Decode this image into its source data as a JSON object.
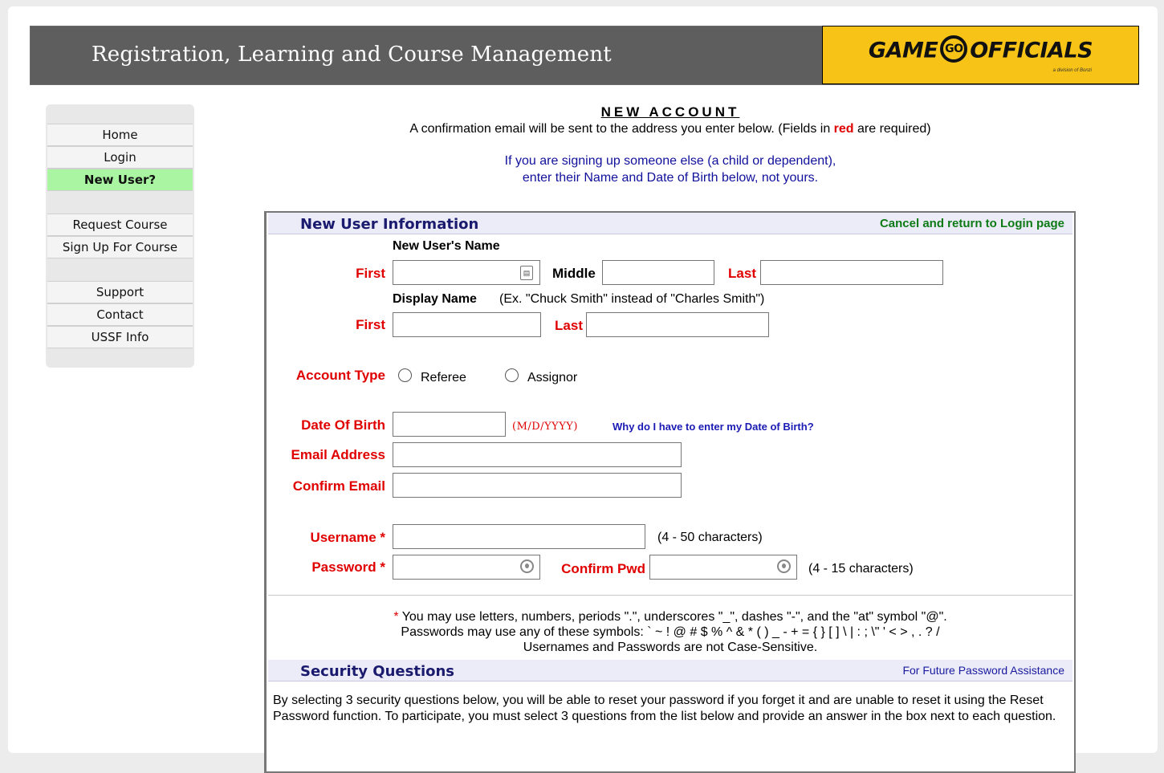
{
  "header": {
    "title": "Registration, Learning and Course Management",
    "logo_left": "GAME",
    "logo_mid": "GO",
    "logo_right": "OFFICIALS",
    "logo_sub": "a division of Bonzi"
  },
  "sidebar": {
    "items": [
      {
        "label": "Home"
      },
      {
        "label": "Login"
      },
      {
        "label": "New User?"
      },
      {
        "label": "Request Course"
      },
      {
        "label": "Sign Up For Course"
      },
      {
        "label": "Support"
      },
      {
        "label": "Contact"
      },
      {
        "label": "USSF Info"
      }
    ]
  },
  "intro": {
    "heading": "NEW ACCOUNT",
    "line1_pre": "A confirmation email will be sent to the address you enter below. (Fields in ",
    "line1_red": "red",
    "line1_post": " are required)",
    "line2": "If you are signing up someone else (a child or dependent),",
    "line3": "enter their Name and Date of Birth below, not yours."
  },
  "user_info": {
    "title": "New User Information",
    "cancel_link": "Cancel and return to Login page",
    "name_heading": "New User's Name",
    "first_label": "First",
    "middle_label": "Middle",
    "last_label": "Last",
    "display_name_heading": "Display Name",
    "display_name_example": "(Ex. \"Chuck Smith\" instead of \"Charles Smith\")",
    "display_first_label": "First",
    "display_last_label": "Last",
    "account_type_label": "Account Type",
    "referee_label": "Referee",
    "assignor_label": "Assignor",
    "dob_label": "Date Of Birth",
    "dob_hint": "(M/D/YYYY)",
    "dob_why": "Why do I have to enter my Date of Birth?",
    "email_label": "Email Address",
    "confirm_email_label": "Confirm Email",
    "username_label": "Username *",
    "username_hint": "(4 - 50 characters)",
    "password_label": "Password *",
    "confirm_pwd_label": "Confirm Pwd",
    "password_hint": "(4 - 15 characters)",
    "note_star": "*",
    "note1": " You may use letters, numbers, periods \".\", underscores \"_\", dashes \"-\", and the \"at\" symbol \"@\".",
    "note2": "Passwords may use any of these symbols: ` ~ ! @ # $ % ^ & * ( ) _ - + = { } [ ] \\ | : ; \\\" ' < > , . ? /",
    "note3": "Usernames and Passwords are not Case-Sensitive."
  },
  "security": {
    "title": "Security Questions",
    "right_text": "For Future Password Assistance",
    "para": "By selecting 3 security questions below, you will be able to reset your password if you forget it and are unable to reset it using the Reset Password function. To participate, you must select 3 questions from the list below and provide an answer in the box next to each question."
  },
  "colors": {
    "required_red": "#e00000",
    "active_nav_green": "#a9f5a2",
    "logo_yellow": "#f7c316",
    "header_gray": "#5e5e5e",
    "link_green": "#0d7a16"
  }
}
